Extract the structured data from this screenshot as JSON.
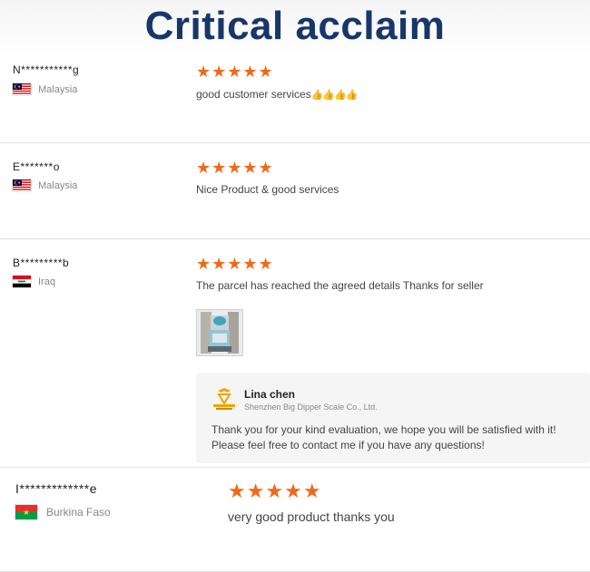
{
  "banner": {
    "title": "Critical acclaim"
  },
  "colors": {
    "title": "#17366b",
    "stars": "#ee6a1a",
    "thumbs": "#e4b100"
  },
  "reviews": [
    {
      "name": "N***********g",
      "country": "Malaysia",
      "flag_icon": "malaysia-flag-icon",
      "rating": 5,
      "stars": "★★★★★",
      "text": "good customer services",
      "emoji": "👍👍👍👍"
    },
    {
      "name": "E*******o",
      "country": "Malaysia",
      "flag_icon": "malaysia-flag-icon",
      "rating": 5,
      "stars": "★★★★★",
      "text": "Nice Product & good services"
    },
    {
      "name": "B*********b",
      "country": "Iraq",
      "flag_icon": "iraq-flag-icon",
      "rating": 5,
      "stars": "★★★★★",
      "text": "The parcel has reached the agreed details Thanks for seller",
      "reply": {
        "seller_name": "Lina chen",
        "company": "Shenzhen Big Dipper Scale Co., Ltd.",
        "line1": "Thank you for your kind evaluation, we hope you will be satisfied with it!",
        "line2": "Please feel free to contact me if you have any questions!"
      }
    },
    {
      "name": "I*************e",
      "country": "Burkina Faso",
      "flag_icon": "burkina-faso-flag-icon",
      "rating": 5,
      "stars": "★★★★★",
      "text": "very good product thanks you"
    }
  ]
}
